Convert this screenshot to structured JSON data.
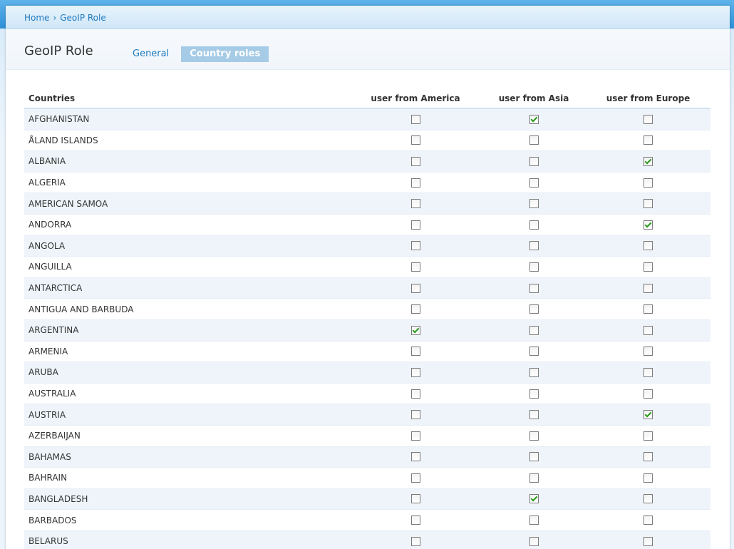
{
  "breadcrumb": {
    "home": "Home",
    "separator": "›",
    "current": "GeoIP Role"
  },
  "page": {
    "title": "GeoIP Role"
  },
  "tabs": [
    {
      "label": "General",
      "active": false
    },
    {
      "label": "Country roles",
      "active": true
    }
  ],
  "table": {
    "headers": {
      "country": "Countries",
      "america": "user from America",
      "asia": "user from Asia",
      "europe": "user from Europe"
    },
    "rows": [
      {
        "country": "AFGHANISTAN",
        "america": false,
        "asia": true,
        "europe": false
      },
      {
        "country": "ÅLAND ISLANDS",
        "america": false,
        "asia": false,
        "europe": false
      },
      {
        "country": "ALBANIA",
        "america": false,
        "asia": false,
        "europe": true
      },
      {
        "country": "ALGERIA",
        "america": false,
        "asia": false,
        "europe": false
      },
      {
        "country": "AMERICAN SAMOA",
        "america": false,
        "asia": false,
        "europe": false
      },
      {
        "country": "ANDORRA",
        "america": false,
        "asia": false,
        "europe": true
      },
      {
        "country": "ANGOLA",
        "america": false,
        "asia": false,
        "europe": false
      },
      {
        "country": "ANGUILLA",
        "america": false,
        "asia": false,
        "europe": false
      },
      {
        "country": "ANTARCTICA",
        "america": false,
        "asia": false,
        "europe": false
      },
      {
        "country": "ANTIGUA AND BARBUDA",
        "america": false,
        "asia": false,
        "europe": false
      },
      {
        "country": "ARGENTINA",
        "america": true,
        "asia": false,
        "europe": false
      },
      {
        "country": "ARMENIA",
        "america": false,
        "asia": false,
        "europe": false
      },
      {
        "country": "ARUBA",
        "america": false,
        "asia": false,
        "europe": false
      },
      {
        "country": "AUSTRALIA",
        "america": false,
        "asia": false,
        "europe": false
      },
      {
        "country": "AUSTRIA",
        "america": false,
        "asia": false,
        "europe": true
      },
      {
        "country": "AZERBAIJAN",
        "america": false,
        "asia": false,
        "europe": false
      },
      {
        "country": "BAHAMAS",
        "america": false,
        "asia": false,
        "europe": false
      },
      {
        "country": "BAHRAIN",
        "america": false,
        "asia": false,
        "europe": false
      },
      {
        "country": "BANGLADESH",
        "america": false,
        "asia": true,
        "europe": false
      },
      {
        "country": "BARBADOS",
        "america": false,
        "asia": false,
        "europe": false
      },
      {
        "country": "BELARUS",
        "america": false,
        "asia": false,
        "europe": false
      }
    ]
  },
  "colors": {
    "link": "#1f7bbf",
    "active_tab_bg": "#a5cbe6",
    "row_alt": "#eef4fa",
    "check": "#2a9a1a"
  }
}
